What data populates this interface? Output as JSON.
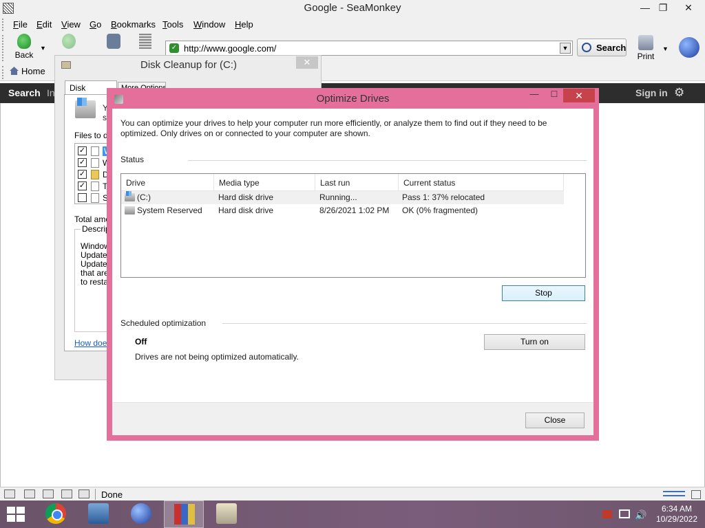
{
  "seamonkey": {
    "title": "Google - SeaMonkey",
    "window_controls": {
      "minimize": "—",
      "maximize": "❐",
      "close": "✕"
    },
    "menu": [
      {
        "pre": "",
        "key": "F",
        "post": "ile"
      },
      {
        "pre": "",
        "key": "E",
        "post": "dit"
      },
      {
        "pre": "",
        "key": "V",
        "post": "iew"
      },
      {
        "pre": "",
        "key": "G",
        "post": "o"
      },
      {
        "pre": "",
        "key": "B",
        "post": "ookmarks"
      },
      {
        "pre": "",
        "key": "T",
        "post": "ools"
      },
      {
        "pre": "",
        "key": "W",
        "post": "indow"
      },
      {
        "pre": "",
        "key": "H",
        "post": "elp"
      }
    ],
    "toolbar": {
      "back_label": "Back",
      "url": "http://www.google.com/",
      "search_label": "Search",
      "print_label": "Print"
    },
    "personal_bar": {
      "home_label": "Home"
    },
    "google_bar": {
      "search": "Search",
      "images": "In",
      "sign_in": "Sign in",
      "gear": "⚙"
    },
    "statusbar": {
      "status_text": "Done"
    }
  },
  "disk_cleanup": {
    "title": "Disk Cleanup for  (C:)",
    "close": "✕",
    "tabs": [
      "Disk Cleanup",
      "More Options"
    ],
    "intro": "Y",
    "intro_line2": "s",
    "files_label": "Files to de",
    "files": [
      {
        "checked": true,
        "label": "W"
      },
      {
        "checked": true,
        "label": "W"
      },
      {
        "checked": true,
        "label": "D"
      },
      {
        "checked": true,
        "label": "Te"
      },
      {
        "checked": false,
        "label": "Sy"
      }
    ],
    "total_label": "Total amou",
    "description_title": "Descript",
    "description_text": "Window\nUpdate,\nUpdate c\nthat are\nto restar",
    "how_link": "How does"
  },
  "optimize_drives": {
    "title": "Optimize Drives",
    "window_controls": {
      "minimize": "—",
      "maximize": "☐",
      "close": "✕"
    },
    "intro": "You can optimize your drives to help your computer run more efficiently, or analyze them to find out if they need to be optimized. Only drives on or connected to your computer are shown.",
    "status_label": "Status",
    "columns": [
      "Drive",
      "Media type",
      "Last run",
      "Current status"
    ],
    "drives": [
      {
        "drive": "(C:)",
        "media_type": "Hard disk drive",
        "last_run": "Running...",
        "current_status": "Pass 1: 37% relocated"
      },
      {
        "drive": "System Reserved",
        "media_type": "Hard disk drive",
        "last_run": "8/26/2021 1:02 PM",
        "current_status": "OK (0% fragmented)"
      }
    ],
    "stop_label": "Stop",
    "scheduled_label": "Scheduled optimization",
    "scheduled_state": "Off",
    "scheduled_desc": "Drives are not being optimized automatically.",
    "turn_on_label": "Turn on",
    "close_label": "Close",
    "accent_color": "#e46f9a"
  },
  "taskbar": {
    "apps": [
      "chrome",
      "network",
      "seamonkey",
      "winrar",
      "disk-cleanup"
    ],
    "active_app": "winrar",
    "time": "6:34 AM",
    "date": "10/29/2022",
    "volume_glyph": "🔊"
  }
}
